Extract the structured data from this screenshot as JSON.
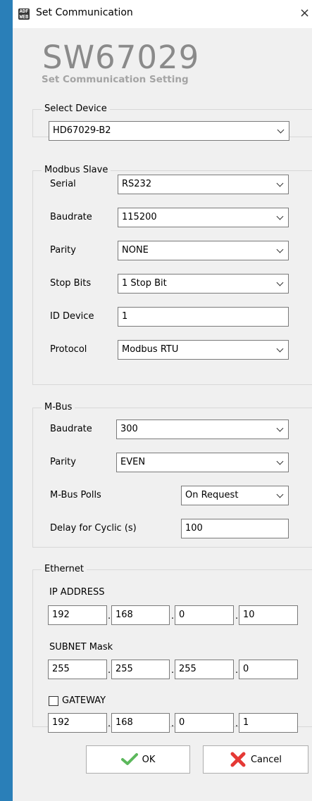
{
  "window": {
    "title": "Set Communication",
    "app_icon_text": "ADF WEB",
    "close_glyph": "×"
  },
  "header": {
    "product": "SW67029",
    "subtitle": "Set Communication Setting"
  },
  "select_device": {
    "legend": "Select Device",
    "device": "HD67029-B2"
  },
  "modbus_slave": {
    "legend": "Modbus Slave",
    "serial_label": "Serial",
    "serial_value": "RS232",
    "baudrate_label": "Baudrate",
    "baudrate_value": "115200",
    "parity_label": "Parity",
    "parity_value": "NONE",
    "stopbits_label": "Stop Bits",
    "stopbits_value": "1 Stop Bit",
    "id_label": "ID Device",
    "id_value": "1",
    "protocol_label": "Protocol",
    "protocol_value": "Modbus RTU"
  },
  "mbus": {
    "legend": "M-Bus",
    "baudrate_label": "Baudrate",
    "baudrate_value": "300",
    "parity_label": "Parity",
    "parity_value": "EVEN",
    "polls_label": "M-Bus Polls",
    "polls_value": "On Request",
    "delay_label": "Delay for Cyclic (s)",
    "delay_value": "100"
  },
  "ethernet": {
    "legend": "Ethernet",
    "ip_label": "IP ADDRESS",
    "ip": [
      "192",
      "168",
      "0",
      "10"
    ],
    "subnet_label": "SUBNET Mask",
    "subnet": [
      "255",
      "255",
      "255",
      "0"
    ],
    "gateway_label": "GATEWAY",
    "gateway_checked": false,
    "gateway": [
      "192",
      "168",
      "0",
      "1"
    ],
    "dot": "."
  },
  "buttons": {
    "ok": "OK",
    "cancel": "Cancel"
  },
  "colors": {
    "titlebar_accent": "#2a7fb8",
    "ok_icon": "#5cb85c",
    "cancel_icon": "#e53935"
  }
}
